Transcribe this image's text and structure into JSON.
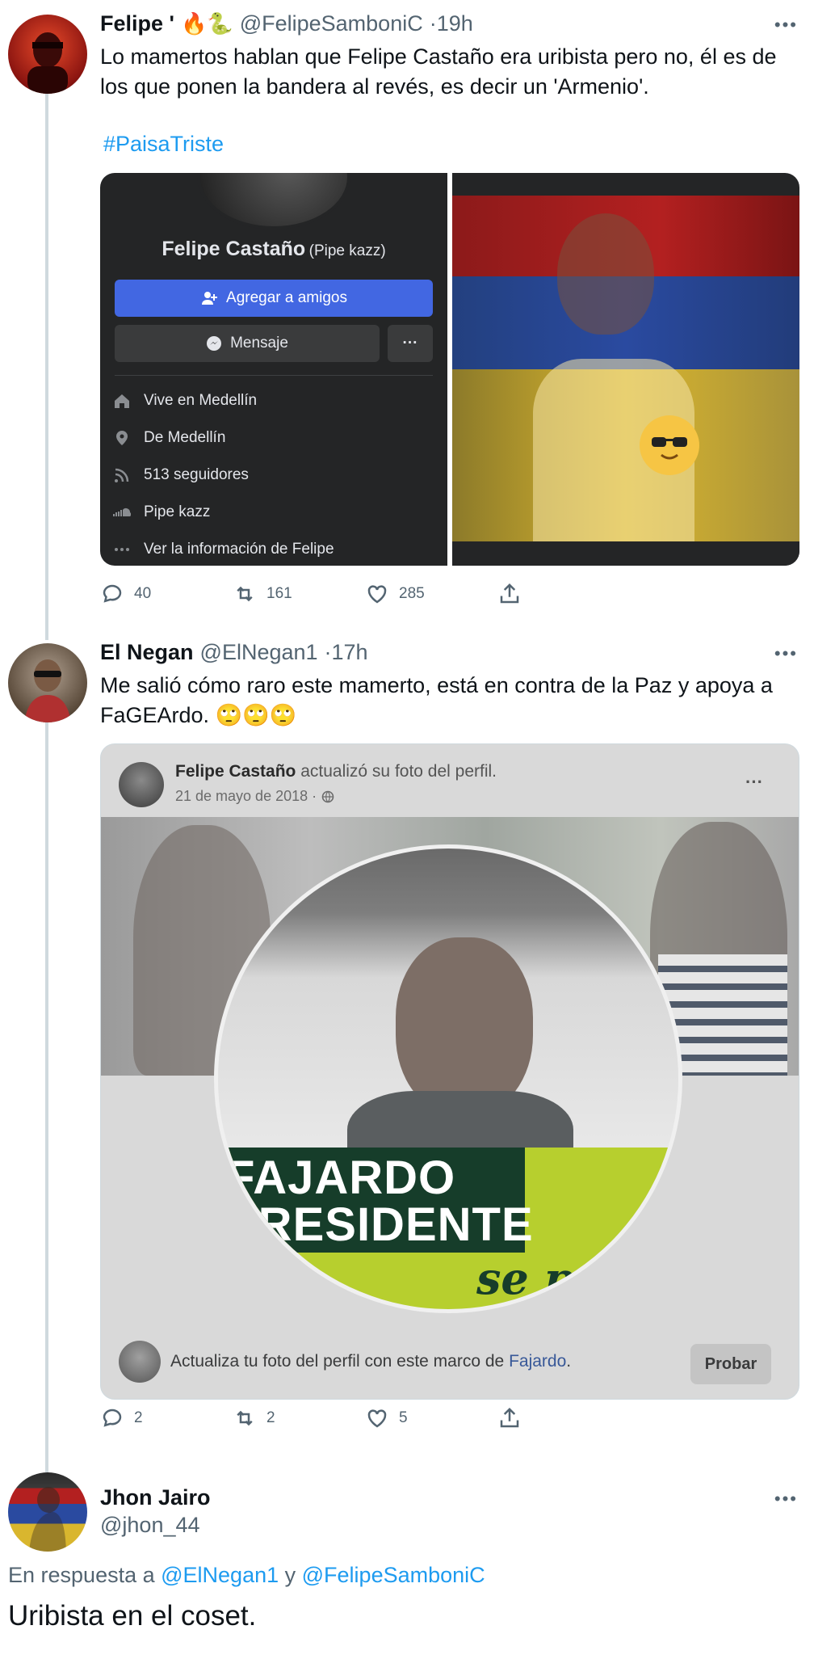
{
  "tweet1": {
    "name": "Felipe '",
    "emojis": "🔥🐍",
    "handle": "@FelipeSamboniC",
    "time": "·19h",
    "text": "Lo mamertos hablan que Felipe Castaño era uribista pero no, él es de los que ponen la bandera al revés, es decir un 'Armenio'.",
    "hashtag": "#PaisaTriste",
    "fb_card": {
      "profile_name": "Felipe Castaño",
      "profile_alias": "(Pipe kazz)",
      "add_friend": "Agregar a amigos",
      "message": "Mensaje",
      "more": "···",
      "info": [
        {
          "prefix": "Vive en ",
          "value": "Medellín",
          "icon": "home-icon"
        },
        {
          "prefix": "De ",
          "value": "Medellín",
          "icon": "location-pin-icon"
        },
        {
          "prefix": "",
          "value": "513 seguidores",
          "icon": "rss-icon"
        },
        {
          "prefix": "",
          "value": "Pipe kazz",
          "icon": "soundcloud-icon"
        },
        {
          "prefix": "",
          "value": "Ver la información de Felipe",
          "icon": "more-dots-icon"
        }
      ]
    },
    "replies": "40",
    "retweets": "161",
    "likes": "285"
  },
  "tweet2": {
    "name": "El Negan",
    "handle": "@ElNegan1",
    "time": "·17h",
    "text": "Me salió cómo raro este mamerto, está en contra de la Paz y apoya a FaGEArdo.",
    "emojis": "🙄🙄🙄",
    "fb_post": {
      "author": "Felipe Castaño",
      "action": " actualizó su foto del perfil.",
      "date": "21 de mayo de 2018 ·",
      "more": "···",
      "banner_line1": "FAJARDO",
      "banner_line2": "PRESIDENTE",
      "banner_script": "se pu",
      "cta_text": "Actualiza tu foto del perfil con este marco de ",
      "cta_link": "Fajardo",
      "cta_end": ".",
      "cta_button": "Probar"
    },
    "replies": "2",
    "retweets": "2",
    "likes": "5"
  },
  "tweet3": {
    "name": "Jhon Jairo",
    "handle": "@jhon_44",
    "reply_prefix": "En respuesta a ",
    "reply_user1": "@ElNegan1",
    "reply_and": " y ",
    "reply_user2": "@FelipeSamboniC",
    "text": "Uribista en el coset."
  },
  "colors": {
    "link": "#1d9bf0",
    "fb_blue": "#4267e2",
    "fb_dark": "#242526",
    "flag_yellow": "#d9b62e",
    "flag_blue": "#2a4aa0",
    "flag_red": "#b32020",
    "fajardo_green": "#b7cf2e"
  }
}
